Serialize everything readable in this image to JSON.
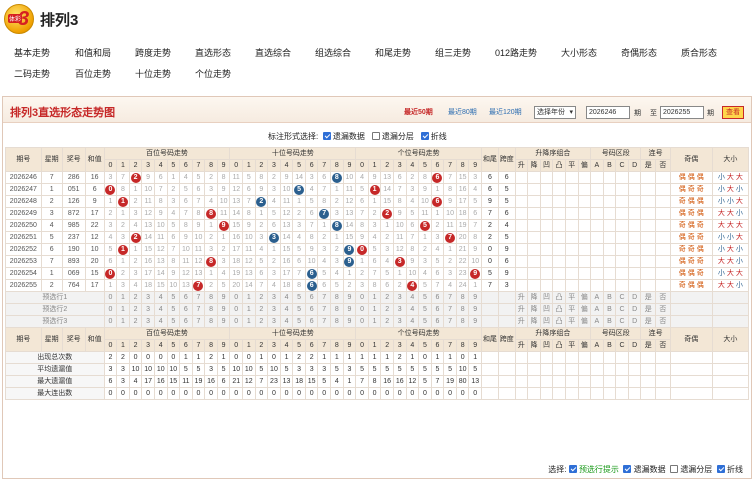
{
  "header": {
    "title": "排列3",
    "logo_text": "3",
    "logo_tag": "体彩"
  },
  "nav": [
    "基本走势",
    "和值和局",
    "跨度走势",
    "直选形态",
    "直选综合",
    "组选综合",
    "和尾走势",
    "组三走势",
    "012路走势",
    "大小形态",
    "奇偶形态",
    "质合形态",
    "二码走势",
    "百位走势",
    "十位走势",
    "个位走势"
  ],
  "panel": {
    "title": "排列3直选形态走势图",
    "periods": [
      "最近50期",
      "最近80期",
      "最近120期"
    ],
    "active_period": "最近50期",
    "select_label": "选择年份",
    "from": "2026246",
    "period_word": "期",
    "to_word": "至",
    "to": "2026255",
    "query": "查看",
    "options_label": "标注形式选择:",
    "options": [
      {
        "label": "遗漏数据",
        "checked": true
      },
      {
        "label": "遗漏分层",
        "checked": false
      },
      {
        "label": "折线",
        "checked": true
      }
    ]
  },
  "table": {
    "head": {
      "issue": "期号",
      "week": "星期",
      "prize": "奖号",
      "sum": "和值",
      "bai": "百位号码走势",
      "shi": "十位号码走势",
      "ge": "个位号码走势",
      "hewei": "和尾",
      "span": "跨度",
      "sort": "升降序组合",
      "zone": "号码区段",
      "lian": "连号",
      "oe": "奇偶",
      "bs": "大小"
    },
    "digits": [
      "0",
      "1",
      "2",
      "3",
      "4",
      "5",
      "6",
      "7",
      "8",
      "9"
    ],
    "sort_cols": [
      "升",
      "降",
      "凹",
      "凸",
      "平",
      "偏"
    ],
    "zone_cols": [
      "A",
      "B",
      "C",
      "D"
    ],
    "lian_cols": [
      "是",
      "否"
    ],
    "rows": [
      {
        "issue": "2026246",
        "week": "7",
        "prize": "286",
        "sum": "16",
        "hewei": "6",
        "span": "6",
        "oe": [
          "偶",
          "偶",
          "偶"
        ],
        "bs": [
          "小",
          "大",
          "大"
        ]
      },
      {
        "issue": "2026247",
        "week": "1",
        "prize": "051",
        "sum": "6",
        "hewei": "6",
        "span": "5",
        "oe": [
          "偶",
          "奇",
          "奇"
        ],
        "bs": [
          "小",
          "大",
          "小"
        ]
      },
      {
        "issue": "2026248",
        "week": "2",
        "prize": "126",
        "sum": "9",
        "hewei": "9",
        "span": "5",
        "oe": [
          "奇",
          "偶",
          "偶"
        ],
        "bs": [
          "小",
          "小",
          "大"
        ]
      },
      {
        "issue": "2026249",
        "week": "3",
        "prize": "872",
        "sum": "17",
        "hewei": "7",
        "span": "6",
        "oe": [
          "偶",
          "奇",
          "偶"
        ],
        "bs": [
          "大",
          "大",
          "小"
        ]
      },
      {
        "issue": "2026250",
        "week": "4",
        "prize": "985",
        "sum": "22",
        "hewei": "2",
        "span": "4",
        "oe": [
          "奇",
          "偶",
          "奇"
        ],
        "bs": [
          "大",
          "大",
          "大"
        ]
      },
      {
        "issue": "2026251",
        "week": "5",
        "prize": "237",
        "sum": "12",
        "hewei": "2",
        "span": "5",
        "oe": [
          "偶",
          "奇",
          "奇"
        ],
        "bs": [
          "小",
          "小",
          "大"
        ]
      },
      {
        "issue": "2026252",
        "week": "6",
        "prize": "190",
        "sum": "10",
        "hewei": "0",
        "span": "9",
        "oe": [
          "奇",
          "奇",
          "偶"
        ],
        "bs": [
          "小",
          "大",
          "小"
        ]
      },
      {
        "issue": "2026253",
        "week": "7",
        "prize": "893",
        "sum": "20",
        "hewei": "0",
        "span": "6",
        "oe": [
          "偶",
          "奇",
          "奇"
        ],
        "bs": [
          "大",
          "大",
          "小"
        ]
      },
      {
        "issue": "2026254",
        "week": "1",
        "prize": "069",
        "sum": "15",
        "hewei": "5",
        "span": "9",
        "oe": [
          "偶",
          "偶",
          "奇"
        ],
        "bs": [
          "小",
          "大",
          "大"
        ]
      },
      {
        "issue": "2026255",
        "week": "2",
        "prize": "764",
        "sum": "17",
        "hewei": "7",
        "span": "3",
        "oe": [
          "奇",
          "偶",
          "偶"
        ],
        "bs": [
          "大",
          "大",
          "小"
        ]
      }
    ],
    "preselect": [
      "预选行1",
      "预选行2",
      "预选行3"
    ],
    "stats": [
      {
        "label": "出现总次数",
        "bai": [
          "2",
          "2",
          "0",
          "0",
          "0",
          "0",
          "1",
          "1",
          "2",
          "1"
        ],
        "shi": [
          "0",
          "0",
          "1",
          "0",
          "1",
          "2",
          "2",
          "1",
          "1",
          "1"
        ],
        "ge": [
          "1",
          "1",
          "1",
          "2",
          "1",
          "0",
          "1",
          "1",
          "0",
          "1"
        ]
      },
      {
        "label": "平均遗漏值",
        "bai": [
          "3",
          "3",
          "10",
          "10",
          "10",
          "10",
          "5",
          "5",
          "3",
          "5"
        ],
        "shi": [
          "10",
          "10",
          "5",
          "10",
          "5",
          "3",
          "3",
          "3",
          "5",
          "3"
        ],
        "ge": [
          "5",
          "5",
          "5",
          "5",
          "5",
          "5",
          "5",
          "5",
          "10",
          "5"
        ]
      },
      {
        "label": "最大遗漏值",
        "bai": [
          "6",
          "3",
          "4",
          "17",
          "16",
          "15",
          "11",
          "19",
          "16",
          "6"
        ],
        "shi": [
          "21",
          "12",
          "7",
          "23",
          "13",
          "18",
          "15",
          "5",
          "4",
          "1"
        ],
        "ge": [
          "7",
          "8",
          "16",
          "16",
          "12",
          "5",
          "7",
          "19",
          "80",
          "13"
        ]
      },
      {
        "label": "最大连出数",
        "bai": [
          "0",
          "0",
          "0",
          "0",
          "0",
          "0",
          "0",
          "0",
          "0",
          "0"
        ],
        "shi": [
          "0",
          "0",
          "0",
          "0",
          "0",
          "0",
          "0",
          "0",
          "0",
          "0"
        ],
        "ge": [
          "0",
          "0",
          "0",
          "0",
          "0",
          "0",
          "0",
          "0",
          "0",
          "0"
        ]
      }
    ]
  },
  "footer": {
    "label": "选择:",
    "options": [
      {
        "label": "预选行提示",
        "checked": true,
        "green": true
      },
      {
        "label": "遗漏数据",
        "checked": true
      },
      {
        "label": "遗漏分层",
        "checked": false
      },
      {
        "label": "折线",
        "checked": true
      }
    ]
  }
}
